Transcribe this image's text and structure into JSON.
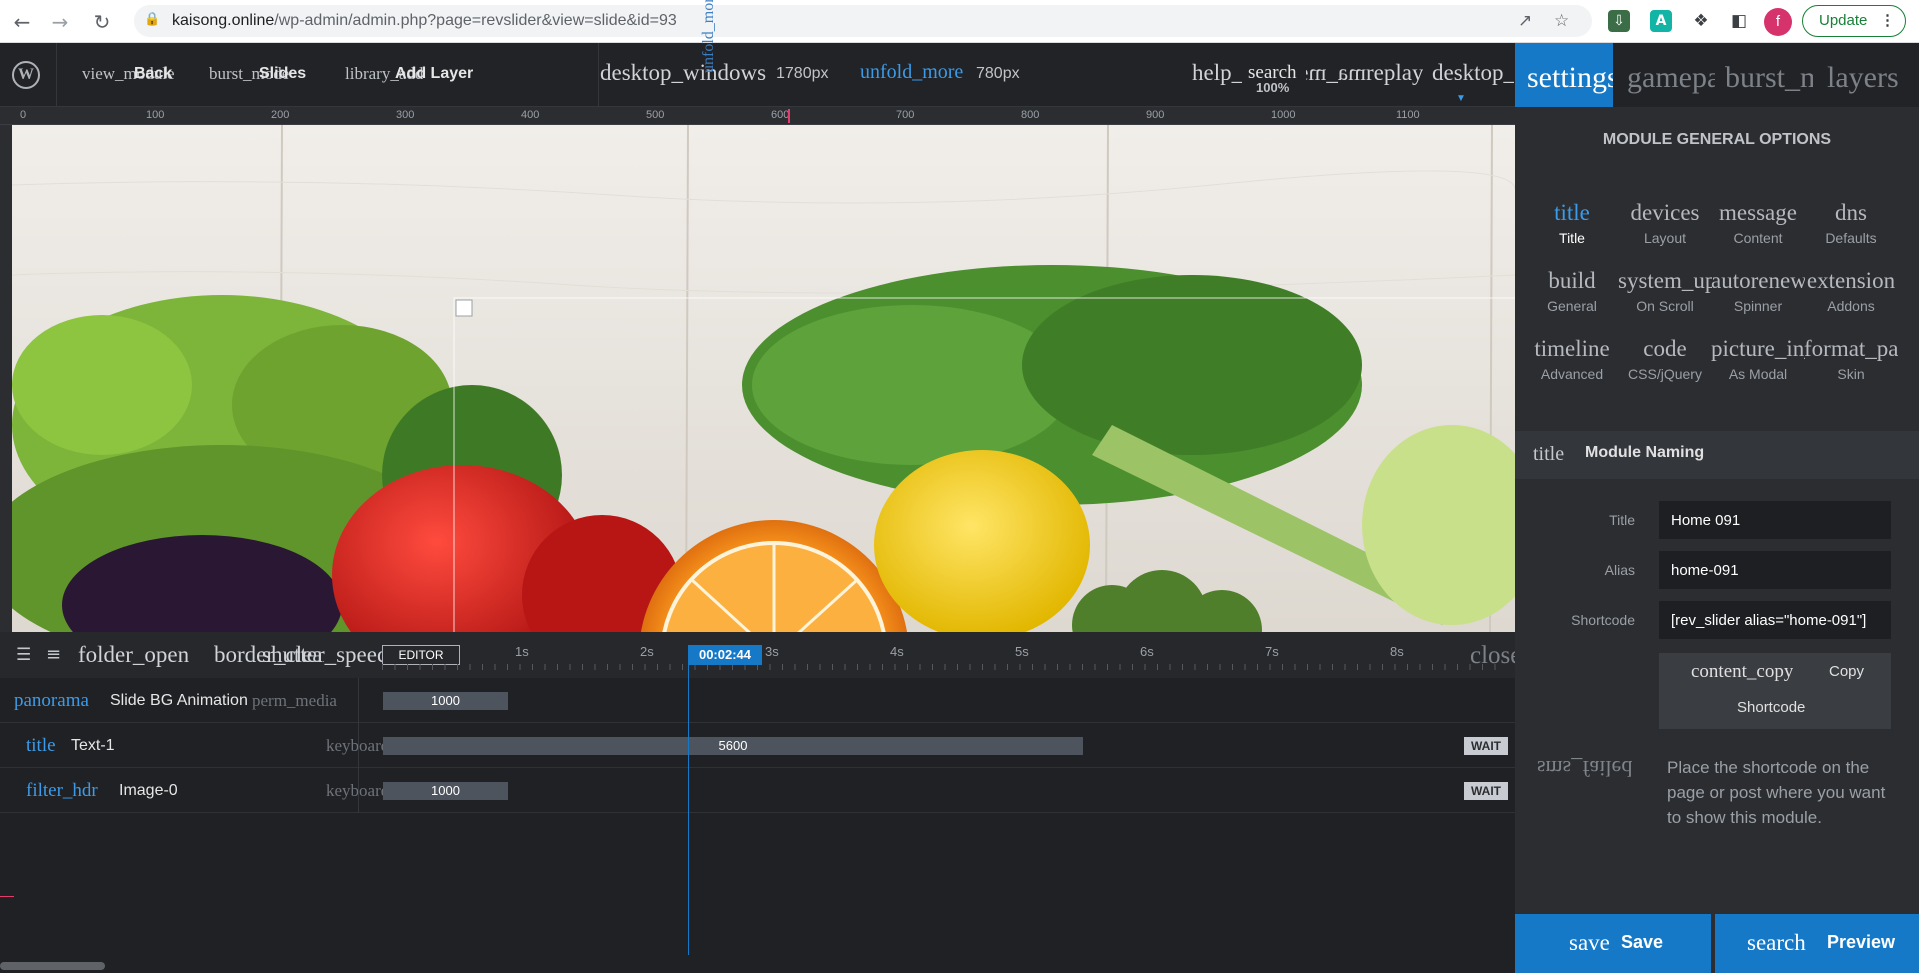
{
  "browser": {
    "url_host": "kaisong.online",
    "url_path": "/wp-admin/admin.php?page=revslider&view=slide&id=93",
    "back_icon": "arrow-left-icon",
    "forward_icon": "arrow-right-icon",
    "reload_icon": "reload-icon",
    "profile_initial": "f",
    "update_label": "Update",
    "extension_a": "A"
  },
  "toolbar": {
    "view_module_icon": "view_module",
    "back_label": "Back",
    "slides_icon": "burst_mode",
    "slides_label": "Slides",
    "library_icon": "library_add",
    "add_layer_label": "Add Layer",
    "desktop_icon": "desktop_windows",
    "width_value": "1780px",
    "unfold_icon": "unfold_more",
    "height_value": "780px",
    "rotated_icon": "unfold_more",
    "help_icon": "help_",
    "search_icon": "search",
    "zoom": "100%",
    "undo_icon": "ma_mɘ",
    "replay_icon": "replay",
    "device_icon": "desktop_"
  },
  "panel": {
    "tabs": [
      "settings",
      "gamepad",
      "burst_mode",
      "layers"
    ],
    "title": "MODULE GENERAL OPTIONS",
    "options": [
      {
        "icon": "title",
        "label": "Title"
      },
      {
        "icon": "devices",
        "label": "Layout"
      },
      {
        "icon": "message",
        "label": "Content"
      },
      {
        "icon": "dns",
        "label": "Defaults"
      },
      {
        "icon": "build",
        "label": "General"
      },
      {
        "icon": "system_update",
        "label": "On Scroll"
      },
      {
        "icon": "autorenew",
        "label": "Spinner"
      },
      {
        "icon": "extension",
        "label": "Addons"
      },
      {
        "icon": "timeline",
        "label": "Advanced"
      },
      {
        "icon": "code",
        "label": "CSS/jQuery"
      },
      {
        "icon": "picture_in_picture",
        "label": "As Modal"
      },
      {
        "icon": "format_paint",
        "label": "Skin"
      }
    ],
    "section_icon": "title",
    "section_label": "Module Naming",
    "fields": {
      "title_label": "Title",
      "title_value": "Home 091",
      "alias_label": "Alias",
      "alias_value": "home-091",
      "shortcode_label": "Shortcode",
      "shortcode_value": "[rev_slider alias=\"home-091\"]"
    },
    "copy_icon": "content_copy",
    "copy_label": "Copy",
    "copy_sub": "Shortcode",
    "help_icon": "sms_failed",
    "help_text": "Place the shortcode on the page or post where you want to show this module.",
    "save_icon": "save",
    "save_label": "Save",
    "preview_icon": "search",
    "preview_label": "Preview"
  },
  "ruler": {
    "ticks": [
      "0",
      "100",
      "200",
      "300",
      "400",
      "500",
      "600",
      "700",
      "800",
      "900",
      "1000",
      "1100"
    ]
  },
  "timeline": {
    "layers_icon": "layers-icon",
    "menu_icon": "menu-icon",
    "folder_icon": "folder_open",
    "border_icon": "border_clear",
    "speed_icon": "shutter_speed",
    "editor_label": "EDITOR",
    "seconds": [
      "1s",
      "2s",
      "3s",
      "4s",
      "5s",
      "6s",
      "7s",
      "8s"
    ],
    "playhead": "00:02:44",
    "close_icon": "close",
    "rows": [
      {
        "icon": "panorama",
        "name": "Slide BG Animation",
        "extra_icon": "perm_media",
        "bar": "1000"
      },
      {
        "icon": "title",
        "name": "Text-1",
        "extra_icon": "keyboard_tab",
        "bar": "5600",
        "wait": "WAIT"
      },
      {
        "icon": "filter_hdr",
        "name": "Image-0",
        "extra_icon": "keyboard_tab",
        "bar": "1000",
        "wait": "WAIT"
      }
    ]
  },
  "colors": {
    "accent": "#1579c8",
    "panel_bg": "#2b2d31",
    "toolbar_bg": "#212326"
  }
}
